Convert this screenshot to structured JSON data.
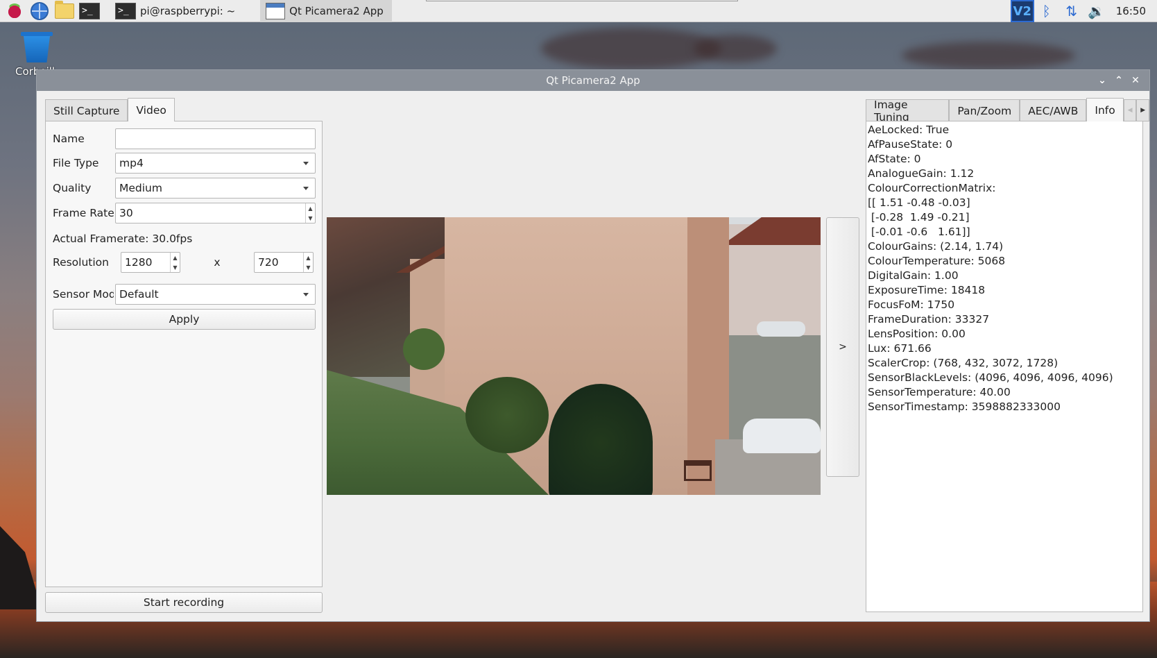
{
  "taskbar": {
    "items": [
      {
        "name": "raspberry-menu"
      },
      {
        "name": "web-browser"
      },
      {
        "name": "file-manager"
      },
      {
        "name": "terminal"
      }
    ],
    "terminal_task_label": "pi@raspberrypi: ~",
    "app_task_label": "Qt Picamera2 App",
    "vnc_label": "V2",
    "clock": "16:50"
  },
  "desktop": {
    "trash_label": "Corbeill"
  },
  "window": {
    "title": "Qt Picamera2 App"
  },
  "left_tabs": [
    "Still Capture",
    "Video"
  ],
  "video_form": {
    "name_label": "Name",
    "name_value": "",
    "file_type_label": "File Type",
    "file_type_value": "mp4",
    "quality_label": "Quality",
    "quality_value": "Medium",
    "frame_rate_label": "Frame Rate",
    "frame_rate_value": "30",
    "actual_framerate": "Actual Framerate: 30.0fps",
    "resolution_label": "Resolution",
    "resolution_width": "1280",
    "resolution_separator": "x",
    "resolution_height": "720",
    "sensor_mode_label": "Sensor Mod",
    "sensor_mode_value": "Default",
    "apply_label": "Apply",
    "start_recording_label": "Start recording"
  },
  "side_button_label": ">",
  "right_tabs": [
    "Image Tuning",
    "Pan/Zoom",
    "AEC/AWB",
    "Info"
  ],
  "info_lines": [
    "AeLocked: True",
    "AfPauseState: 0",
    "AfState: 0",
    "AnalogueGain: 1.12",
    "ColourCorrectionMatrix:",
    "[[ 1.51 -0.48 -0.03]",
    " [-0.28  1.49 -0.21]",
    " [-0.01 -0.6   1.61]]",
    "ColourGains: (2.14, 1.74)",
    "ColourTemperature: 5068",
    "DigitalGain: 1.00",
    "ExposureTime: 18418",
    "FocusFoM: 1750",
    "FrameDuration: 33327",
    "LensPosition: 0.00",
    "Lux: 671.66",
    "ScalerCrop: (768, 432, 3072, 1728)",
    "SensorBlackLevels: (4096, 4096, 4096, 4096)",
    "SensorTemperature: 40.00",
    "SensorTimestamp: 3598882333000"
  ]
}
